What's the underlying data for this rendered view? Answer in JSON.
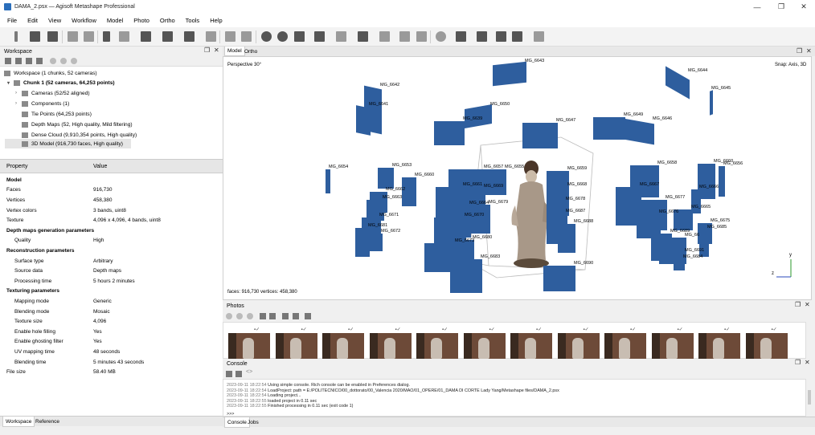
{
  "window": {
    "title": "DAMA_2.psx — Agisoft Metashape Professional",
    "controls": [
      "—",
      "❐",
      "✕"
    ]
  },
  "menu": [
    "File",
    "Edit",
    "View",
    "Workflow",
    "Model",
    "Photo",
    "Ortho",
    "Tools",
    "Help"
  ],
  "workspace": {
    "title": "Workspace",
    "tree": [
      {
        "label": "Workspace (1 chunks, 52 cameras)",
        "level": 0
      },
      {
        "label": "Chunk 1 (52 cameras, 64,253 points)",
        "level": 1,
        "bold": true
      },
      {
        "label": "Cameras (52/52 aligned)",
        "level": 2
      },
      {
        "label": "Components (1)",
        "level": 2
      },
      {
        "label": "Tie Points (64,253 points)",
        "level": 2
      },
      {
        "label": "Depth Maps (52, High quality, Mild filtering)",
        "level": 2
      },
      {
        "label": "Dense Cloud (9,910,354 points, High quality)",
        "level": 2
      },
      {
        "label": "3D Model (916,730 faces, High quality)",
        "level": 2,
        "selected": true
      }
    ],
    "properties": {
      "header": {
        "property": "Property",
        "value": "Value"
      },
      "rows": [
        {
          "k": "Model",
          "v": "",
          "section": true
        },
        {
          "k": "Faces",
          "v": "916,730"
        },
        {
          "k": "Vertices",
          "v": "458,380"
        },
        {
          "k": "Vertex colors",
          "v": "3 bands, uint8"
        },
        {
          "k": "Texture",
          "v": "4,096 x 4,096, 4 bands, uint8"
        },
        {
          "k": "Depth maps generation parameters",
          "v": "",
          "section": true
        },
        {
          "k": "Quality",
          "v": "High",
          "indent": true
        },
        {
          "k": "Reconstruction parameters",
          "v": "",
          "section": true
        },
        {
          "k": "Surface type",
          "v": "Arbitrary",
          "indent": true
        },
        {
          "k": "Source data",
          "v": "Depth maps",
          "indent": true
        },
        {
          "k": "Processing time",
          "v": "5 hours 2 minutes",
          "indent": true
        },
        {
          "k": "Texturing parameters",
          "v": "",
          "section": true
        },
        {
          "k": "Mapping mode",
          "v": "Generic",
          "indent": true
        },
        {
          "k": "Blending mode",
          "v": "Mosaic",
          "indent": true
        },
        {
          "k": "Texture size",
          "v": "4,096",
          "indent": true
        },
        {
          "k": "Enable hole filling",
          "v": "Yes",
          "indent": true
        },
        {
          "k": "Enable ghosting filter",
          "v": "Yes",
          "indent": true
        },
        {
          "k": "UV mapping time",
          "v": "48 seconds",
          "indent": true
        },
        {
          "k": "Blending time",
          "v": "5 minutes 43 seconds",
          "indent": true
        },
        {
          "k": "File size",
          "v": "58.40 MB"
        }
      ]
    },
    "tabs": [
      "Workspace",
      "Reference"
    ]
  },
  "view": {
    "tabs": [
      "Model",
      "Ortho"
    ],
    "perspective": "Perspective 30°",
    "snap": "Snap: Axis, 3D",
    "stats": "faces: 916,730 vertices: 458,380",
    "axes": {
      "x": "x",
      "y": "y",
      "z": "z"
    },
    "camera_labels": [
      "MG_6643",
      "MG_6644",
      "MG_6642",
      "MG_6645",
      "MG_6641",
      "MG_6650",
      "MG_6639",
      "MG_6647",
      "MG_6649",
      "MG_6646",
      "MG_6654",
      "MG_6653",
      "MG_6660",
      "MG_6657",
      "MG_6655",
      "MG_6659",
      "MG_6658",
      "MG_6660",
      "MG_6656",
      "MG_6662",
      "MG_6661",
      "MG_6669",
      "MG_6668",
      "MG_6667",
      "MG_6666",
      "MG_6663",
      "MG_6664",
      "MG_6679",
      "MG_6678",
      "MG_6677",
      "MG_6665",
      "MG_6671",
      "MG_6670",
      "MG_6676",
      "MG_6675",
      "MG_6681",
      "MG_6687",
      "MG_6688",
      "MG_6689",
      "MG_6672",
      "MG_6674",
      "MG_6685",
      "MG_6680",
      "MG_6673",
      "MG_6691",
      "MG_6684",
      "MG_6683",
      "MG_6690"
    ]
  },
  "photos": {
    "title": "Photos",
    "count_shown": 12
  },
  "console": {
    "title": "Console",
    "lines": [
      {
        "ts": "2023-09-11 18:22:54",
        "text": "Using simple console. Rich console can be enabled in Preferences dialog."
      },
      {
        "ts": "2023-09-11 18:22:54",
        "text": "LoadProject: path = E:/POLITECNICO/00_dottorato/00_Valencia 2020/MAO/01_OPERE/01_DAMA DI CORTE Lady Yang/Metashape files/DAMA_2.psx"
      },
      {
        "ts": "2023-09-11 18:22:54",
        "text": "Loading project..."
      },
      {
        "ts": "2023-09-11 18:22:55",
        "text": "loaded project in 0.11 sec"
      },
      {
        "ts": "2023-09-11 18:22:55",
        "text": "Finished processing in 0.11 sec (exit code 1)"
      }
    ],
    "prompt": ">>>",
    "tabs": [
      "Console",
      "Jobs"
    ]
  },
  "colors": {
    "camera": "#2e5e9e",
    "accent": "#2a6ebb"
  }
}
